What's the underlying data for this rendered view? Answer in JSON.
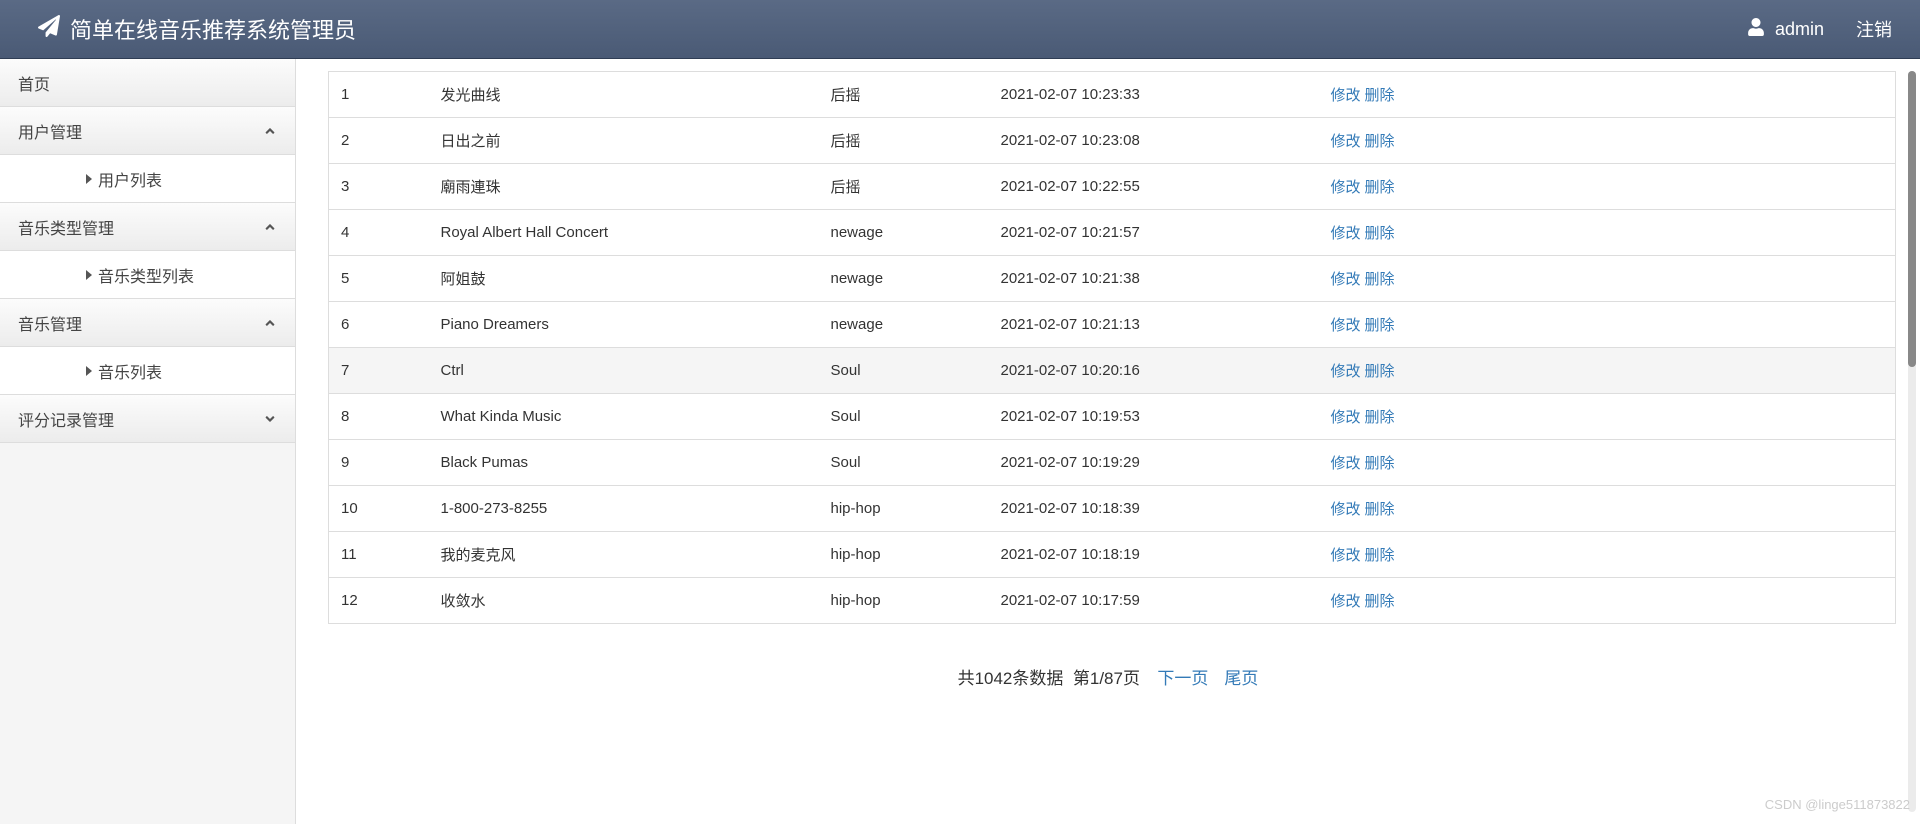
{
  "header": {
    "title": "简单在线音乐推荐系统管理员",
    "user": "admin",
    "logout": "注销"
  },
  "sidebar": {
    "home": "首页",
    "groups": [
      {
        "label": "用户管理",
        "expanded": true,
        "items": [
          {
            "label": "用户列表"
          }
        ]
      },
      {
        "label": "音乐类型管理",
        "expanded": true,
        "items": [
          {
            "label": "音乐类型列表"
          }
        ]
      },
      {
        "label": "音乐管理",
        "expanded": true,
        "items": [
          {
            "label": "音乐列表"
          }
        ]
      },
      {
        "label": "评分记录管理",
        "expanded": false,
        "items": []
      }
    ]
  },
  "table": {
    "actions": {
      "edit": "修改",
      "delete": "删除"
    },
    "rows": [
      {
        "idx": "1",
        "name": "发光曲线",
        "type": "后摇",
        "time": "2021-02-07 10:23:33"
      },
      {
        "idx": "2",
        "name": "日出之前",
        "type": "后摇",
        "time": "2021-02-07 10:23:08"
      },
      {
        "idx": "3",
        "name": "廟雨連珠",
        "type": "后摇",
        "time": "2021-02-07 10:22:55"
      },
      {
        "idx": "4",
        "name": "Royal Albert Hall Concert",
        "type": "newage",
        "time": "2021-02-07 10:21:57"
      },
      {
        "idx": "5",
        "name": "阿姐鼓",
        "type": "newage",
        "time": "2021-02-07 10:21:38"
      },
      {
        "idx": "6",
        "name": "Piano Dreamers",
        "type": "newage",
        "time": "2021-02-07 10:21:13"
      },
      {
        "idx": "7",
        "name": "Ctrl",
        "type": "Soul",
        "time": "2021-02-07 10:20:16"
      },
      {
        "idx": "8",
        "name": "What Kinda Music",
        "type": "Soul",
        "time": "2021-02-07 10:19:53"
      },
      {
        "idx": "9",
        "name": "Black Pumas",
        "type": "Soul",
        "time": "2021-02-07 10:19:29"
      },
      {
        "idx": "10",
        "name": "1-800-273-8255",
        "type": "hip-hop",
        "time": "2021-02-07 10:18:39"
      },
      {
        "idx": "11",
        "name": "我的麦克风",
        "type": "hip-hop",
        "time": "2021-02-07 10:18:19"
      },
      {
        "idx": "12",
        "name": "收敛水",
        "type": "hip-hop",
        "time": "2021-02-07 10:17:59"
      }
    ]
  },
  "pager": {
    "summary_prefix": "共",
    "total": "1042",
    "summary_mid": "条数据",
    "page_prefix": "第",
    "current": "1",
    "sep": "/",
    "pages": "87",
    "page_suffix": "页",
    "next": "下一页",
    "last": "尾页"
  },
  "watermark": "CSDN @linge511873822"
}
